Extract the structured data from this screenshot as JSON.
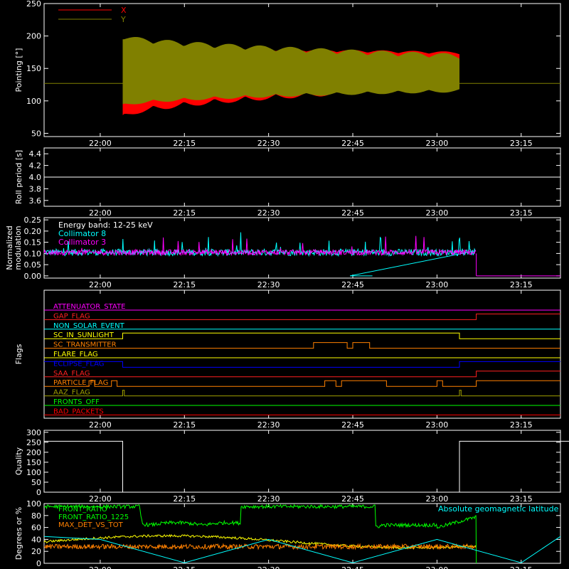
{
  "chart_data": [
    {
      "type": "area",
      "ylabel": "Pointing [°]",
      "ylim": [
        45,
        250
      ],
      "yticks": [
        50,
        100,
        150,
        200,
        250
      ],
      "xticks": [
        "22:00",
        "22:15",
        "22:30",
        "22:45",
        "23:00",
        "23:15"
      ],
      "xlim_minutes_after_2150": [
        0,
        92
      ],
      "active_interval": [
        "22:04",
        "23:04"
      ],
      "baseline": 127,
      "legend": [
        "X",
        "Y"
      ],
      "series": [
        {
          "name": "X",
          "color": "#ff0000",
          "upper_start": 185,
          "upper_end": 172,
          "lower_start": 78,
          "lower_end": 126
        },
        {
          "name": "Y",
          "color": "#808000",
          "upper_start": 195,
          "upper_end": 165,
          "lower_start": 95,
          "lower_end": 118
        }
      ]
    },
    {
      "type": "line",
      "ylabel": "Roll period [s]",
      "ylim": [
        3.5,
        4.5
      ],
      "yticks": [
        3.6,
        3.8,
        4.0,
        4.2,
        4.4
      ],
      "value": 4.0,
      "xticks": [
        "22:00",
        "22:15",
        "22:30",
        "22:45",
        "23:00",
        "23:15"
      ]
    },
    {
      "type": "line",
      "ylabel": "Normalized modulation",
      "ylim": [
        -0.01,
        0.26
      ],
      "yticks": [
        0.0,
        0.05,
        0.1,
        0.15,
        0.2,
        0.25
      ],
      "xticks": [
        "22:00",
        "22:15",
        "22:30",
        "22:45",
        "23:00",
        "23:15"
      ],
      "annotations": [
        "Energy band: 12-25 keV",
        "Collimator 8",
        "Collimator 3"
      ],
      "series": [
        {
          "name": "Collimator 8",
          "color": "#00ffff",
          "mean": 0.105,
          "noise": 0.015
        },
        {
          "name": "Collimator 3",
          "color": "#ff00ff",
          "mean": 0.105,
          "noise": 0.012
        }
      ],
      "end": "23:07"
    },
    {
      "type": "line",
      "ylabel": "Flags",
      "xticks": [
        "22:00",
        "22:15",
        "22:30",
        "22:45",
        "23:00",
        "23:15"
      ],
      "flags": [
        {
          "name": "ATTENUATOR_STATE",
          "color": "#ff00ff"
        },
        {
          "name": "GAP_FLAG",
          "color": "#ff2020"
        },
        {
          "name": "NON_SOLAR_EVENT",
          "color": "#00ffff"
        },
        {
          "name": "SC_IN_SUNLIGHT",
          "color": "#ffff00"
        },
        {
          "name": "SC_TRANSMITTER",
          "color": "#ff8000"
        },
        {
          "name": "FLARE_FLAG",
          "color": "#ffff00"
        },
        {
          "name": "ECLIPSE_FLAG",
          "color": "#0000ff"
        },
        {
          "name": "SAA_FLAG",
          "color": "#ff2020"
        },
        {
          "name": "PARTICLE_FLAG",
          "color": "#ff8000"
        },
        {
          "name": "AAZ_FLAG",
          "color": "#a0a000"
        },
        {
          "name": "FRONTS_OFF",
          "color": "#00ff00"
        },
        {
          "name": "BAD_PACKETS",
          "color": "#ff0000"
        }
      ]
    },
    {
      "type": "line",
      "ylabel": "Quality",
      "ylim": [
        0,
        310
      ],
      "yticks": [
        0,
        50,
        100,
        150,
        200,
        250,
        300
      ],
      "xticks": [
        "22:00",
        "22:15",
        "22:30",
        "22:45",
        "23:00",
        "23:15"
      ],
      "x": [
        "21:50",
        "22:04",
        "22:04",
        "23:04",
        "23:04",
        "23:32"
      ],
      "values": [
        255,
        255,
        0,
        0,
        255,
        255
      ]
    },
    {
      "type": "line",
      "ylabel": "Degrees or %",
      "ylim": [
        0,
        100
      ],
      "yticks": [
        0,
        20,
        40,
        60,
        80,
        100
      ],
      "xticks": [
        "22:00",
        "22:15",
        "22:30",
        "22:45",
        "23:00",
        "23:15"
      ],
      "annotation": "Absolute geomagnetic latitude",
      "series": [
        {
          "name": "FRONT_RATIO",
          "color": "#00ff00"
        },
        {
          "name": "FRONT_RATIO_1225",
          "color": "#00ff00"
        },
        {
          "name": "MAX_DET_VS_TOT",
          "color": "#ff8000"
        },
        {
          "name": "Absolute geomagnetic latitude",
          "color": "#00ffff"
        }
      ]
    }
  ]
}
